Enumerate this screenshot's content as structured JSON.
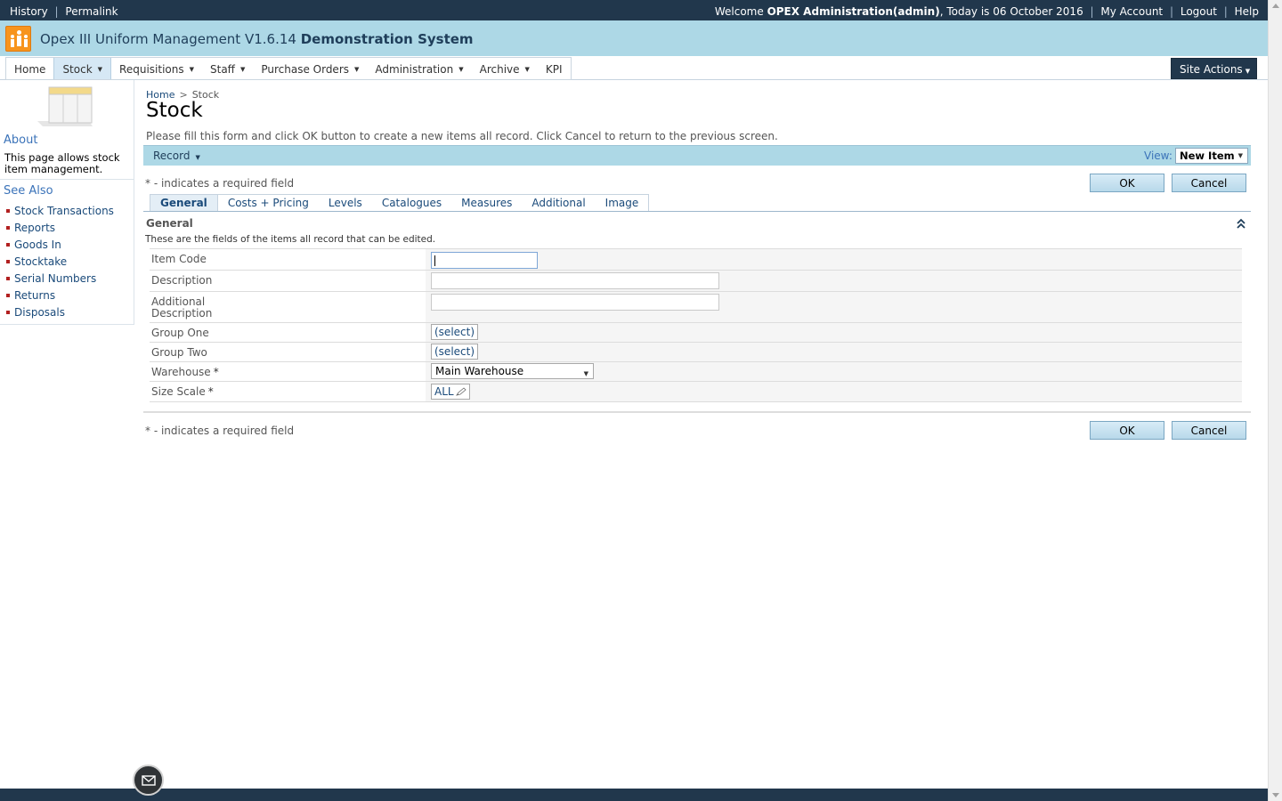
{
  "topbar": {
    "history": "History",
    "permalink": "Permalink",
    "welcome_prefix": "Welcome ",
    "user": "OPEX Administration(admin)",
    "today_text": ", Today is 06 October 2016",
    "my_account": "My Account",
    "logout": "Logout",
    "help": "Help",
    "separator": "|"
  },
  "header": {
    "title_regular": "Opex III Uniform Management V1.6.14 ",
    "title_bold": "Demonstration System"
  },
  "nav": {
    "items": [
      {
        "label": "Home",
        "dropdown": false
      },
      {
        "label": "Stock",
        "dropdown": true
      },
      {
        "label": "Requisitions",
        "dropdown": true
      },
      {
        "label": "Staff",
        "dropdown": true
      },
      {
        "label": "Purchase Orders",
        "dropdown": true
      },
      {
        "label": "Administration",
        "dropdown": true
      },
      {
        "label": "Archive",
        "dropdown": true
      },
      {
        "label": "KPI",
        "dropdown": false
      }
    ],
    "active": "Stock",
    "site_actions": "Site Actions"
  },
  "sidebar": {
    "about_heading": "About",
    "about_text": "This page allows stock item management.",
    "see_also_heading": "See Also",
    "links": [
      "Stock Transactions",
      "Reports",
      "Goods In",
      "Stocktake",
      "Serial Numbers",
      "Returns",
      "Disposals"
    ]
  },
  "breadcrumb": {
    "home": "Home",
    "sep": ">",
    "current": "Stock"
  },
  "page": {
    "title": "Stock",
    "instructions": "Please fill this form and click OK button to create a new items all record. Click Cancel to return to the previous screen."
  },
  "toolbar": {
    "record": "Record",
    "view_label": "View:",
    "view_value": "New Item"
  },
  "required_note": "* - indicates a required field",
  "buttons": {
    "ok": "OK",
    "cancel": "Cancel"
  },
  "tabs": [
    "General",
    "Costs + Pricing",
    "Levels",
    "Catalogues",
    "Measures",
    "Additional",
    "Image"
  ],
  "active_tab": "General",
  "section": {
    "title": "General",
    "description": "These are the fields of the items all record that can be edited."
  },
  "form": {
    "item_code": {
      "label": "Item Code",
      "value": ""
    },
    "description": {
      "label": "Description",
      "value": ""
    },
    "additional_description": {
      "label_line1": "Additional",
      "label_line2": "Description",
      "value": ""
    },
    "group_one": {
      "label": "Group One",
      "button": "(select)"
    },
    "group_two": {
      "label": "Group Two",
      "button": "(select)"
    },
    "warehouse": {
      "label": "Warehouse",
      "required": "*",
      "value": "Main Warehouse"
    },
    "size_scale": {
      "label": "Size Scale",
      "required": "*",
      "value": "ALL"
    }
  },
  "colors": {
    "topbar": "#21374c",
    "header": "#add8e6",
    "link": "#1a4a7a",
    "accent_logo": "#f7941d"
  },
  "icons": [
    "people-logo-icon",
    "chevron-down-icon",
    "collapse-up-icon",
    "pencil-icon",
    "mail-icon"
  ]
}
